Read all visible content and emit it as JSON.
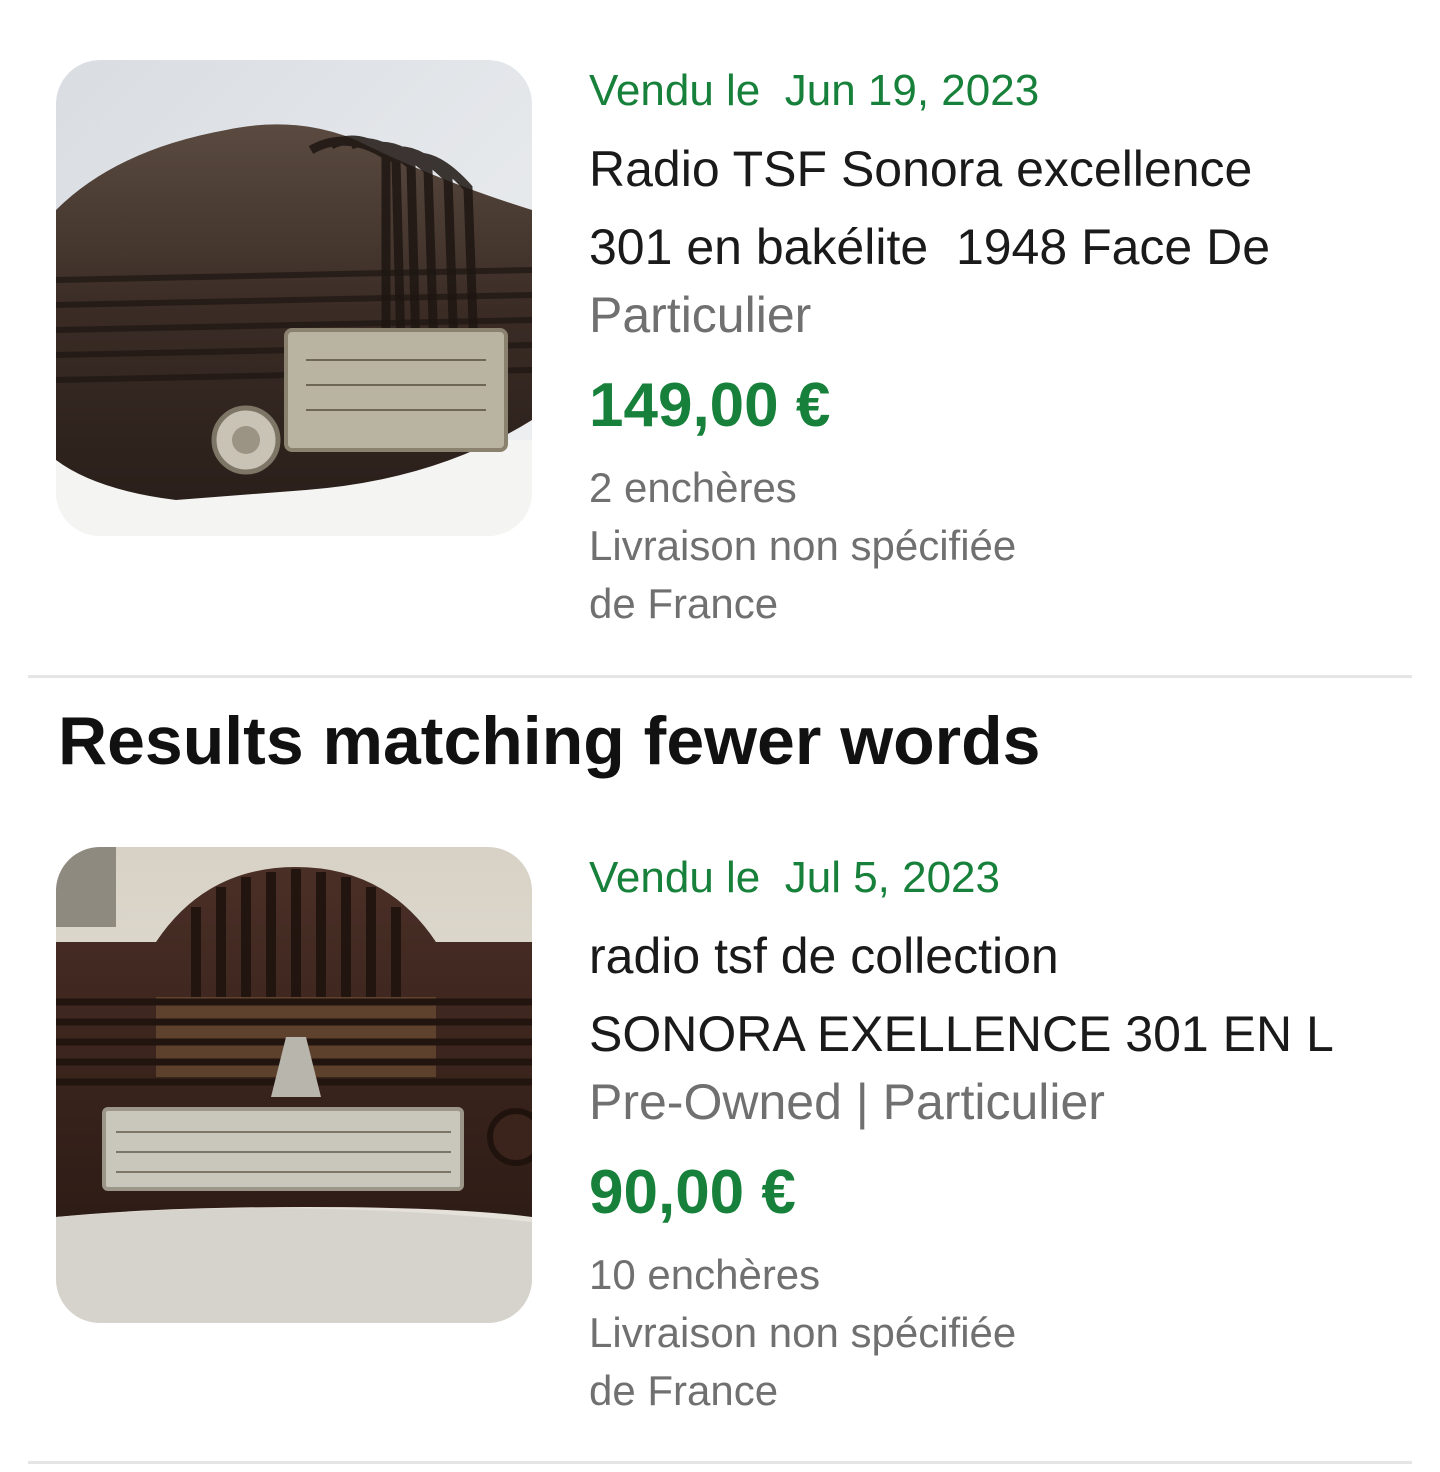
{
  "listings_top": [
    {
      "sold_date": "Vendu le  Jun 19, 2023",
      "title_line_1": "Radio TSF Sonora excellence",
      "title_line_2": "301 en bakélite  1948 Face De",
      "subtitle": "Particulier",
      "price": "149,00 €",
      "bids": "2 enchères",
      "shipping": "Livraison non spécifiée",
      "origin": "de France"
    }
  ],
  "section": {
    "heading": "Results matching fewer words"
  },
  "listings_fewer": [
    {
      "sold_date": "Vendu le  Jul 5, 2023",
      "title_line_1": "radio tsf de collection",
      "title_line_2": "SONORA EXELLENCE 301 EN L",
      "subtitle": "Pre-Owned | Particulier",
      "price": "90,00 €",
      "bids": "10 enchères",
      "shipping": "Livraison non spécifiée",
      "origin": "de France"
    }
  ],
  "colors": {
    "sold_green": "#17803a",
    "price_green": "#17803a",
    "secondary_text": "#707070",
    "divider": "#e5e5e5"
  }
}
